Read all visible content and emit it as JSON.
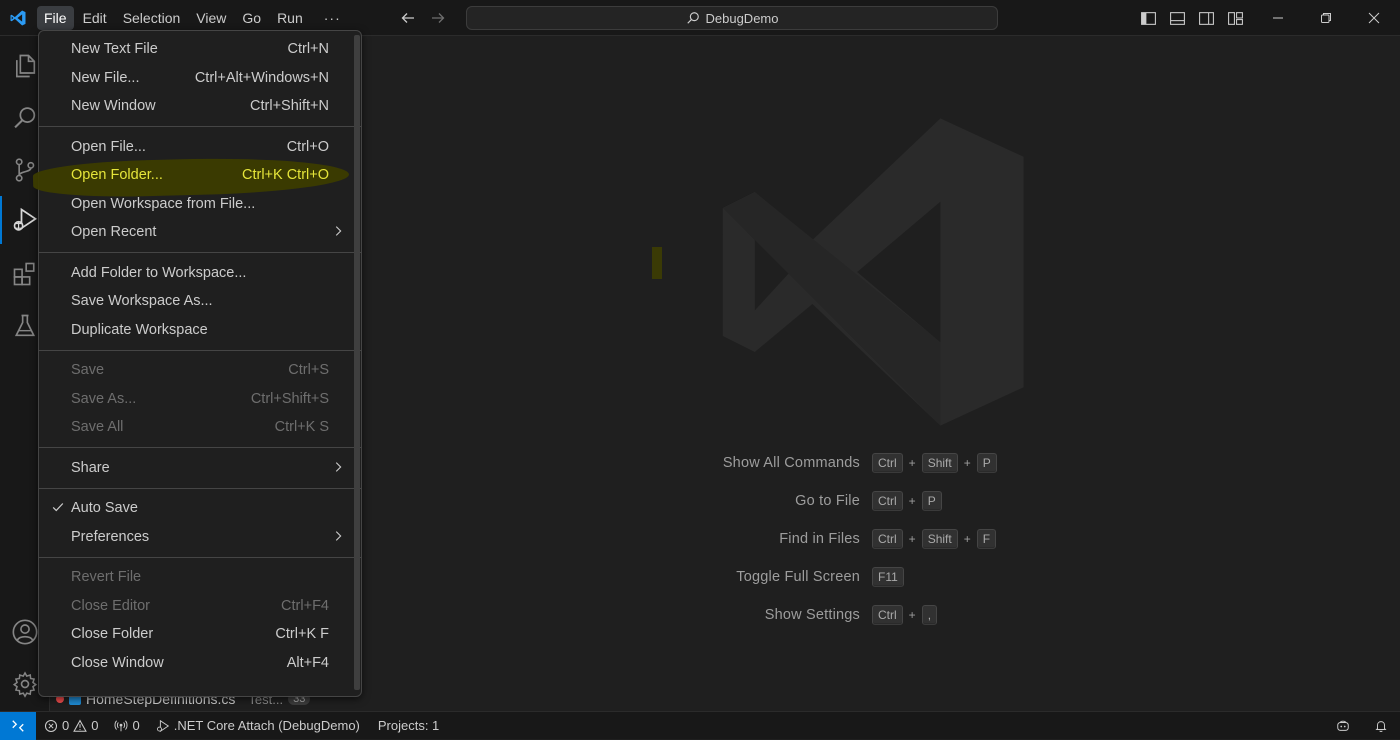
{
  "titlebar": {
    "menu": [
      "File",
      "Edit",
      "Selection",
      "View",
      "Go",
      "Run"
    ],
    "more": "···",
    "command_center": "DebugDemo"
  },
  "file_menu": {
    "groups": [
      [
        {
          "label": "New Text File",
          "shortcut": "Ctrl+N"
        },
        {
          "label": "New File...",
          "shortcut": "Ctrl+Alt+Windows+N"
        },
        {
          "label": "New Window",
          "shortcut": "Ctrl+Shift+N"
        }
      ],
      [
        {
          "label": "Open File...",
          "shortcut": "Ctrl+O"
        },
        {
          "label": "Open Folder...",
          "shortcut": "Ctrl+K Ctrl+O"
        },
        {
          "label": "Open Workspace from File...",
          "shortcut": ""
        },
        {
          "label": "Open Recent",
          "shortcut": ""
        }
      ],
      [
        {
          "label": "Add Folder to Workspace...",
          "shortcut": ""
        },
        {
          "label": "Save Workspace As...",
          "shortcut": ""
        },
        {
          "label": "Duplicate Workspace",
          "shortcut": ""
        }
      ],
      [
        {
          "label": "Save",
          "shortcut": "Ctrl+S"
        },
        {
          "label": "Save As...",
          "shortcut": "Ctrl+Shift+S"
        },
        {
          "label": "Save All",
          "shortcut": "Ctrl+K S"
        }
      ],
      [
        {
          "label": "Share",
          "shortcut": ""
        }
      ],
      [
        {
          "label": "Auto Save",
          "shortcut": ""
        },
        {
          "label": "Preferences",
          "shortcut": ""
        }
      ],
      [
        {
          "label": "Revert File",
          "shortcut": ""
        },
        {
          "label": "Close Editor",
          "shortcut": "Ctrl+F4"
        },
        {
          "label": "Close Folder",
          "shortcut": "Ctrl+K F"
        },
        {
          "label": "Close Window",
          "shortcut": "Alt+F4"
        }
      ]
    ]
  },
  "shortcuts": [
    {
      "label": "Show All Commands",
      "keys": [
        "Ctrl",
        "Shift",
        "P"
      ]
    },
    {
      "label": "Go to File",
      "keys": [
        "Ctrl",
        "P"
      ]
    },
    {
      "label": "Find in Files",
      "keys": [
        "Ctrl",
        "Shift",
        "F"
      ]
    },
    {
      "label": "Toggle Full Screen",
      "keys": [
        "F11"
      ]
    },
    {
      "label": "Show Settings",
      "keys": [
        "Ctrl",
        ","
      ]
    }
  ],
  "shortcut_plus": "+",
  "hidden_tab": {
    "filename": "HomeStepDefinitions.cs",
    "path": "Test...",
    "badge": "33"
  },
  "statusbar": {
    "errors": "0",
    "warnings": "0",
    "ports": "0",
    "debug_config": ".NET Core Attach (DebugDemo)",
    "projects": "Projects: 1"
  },
  "colors": {
    "accent": "#0078d4",
    "highlight_text": "#e5e53a",
    "marker": "#3c3c00"
  }
}
